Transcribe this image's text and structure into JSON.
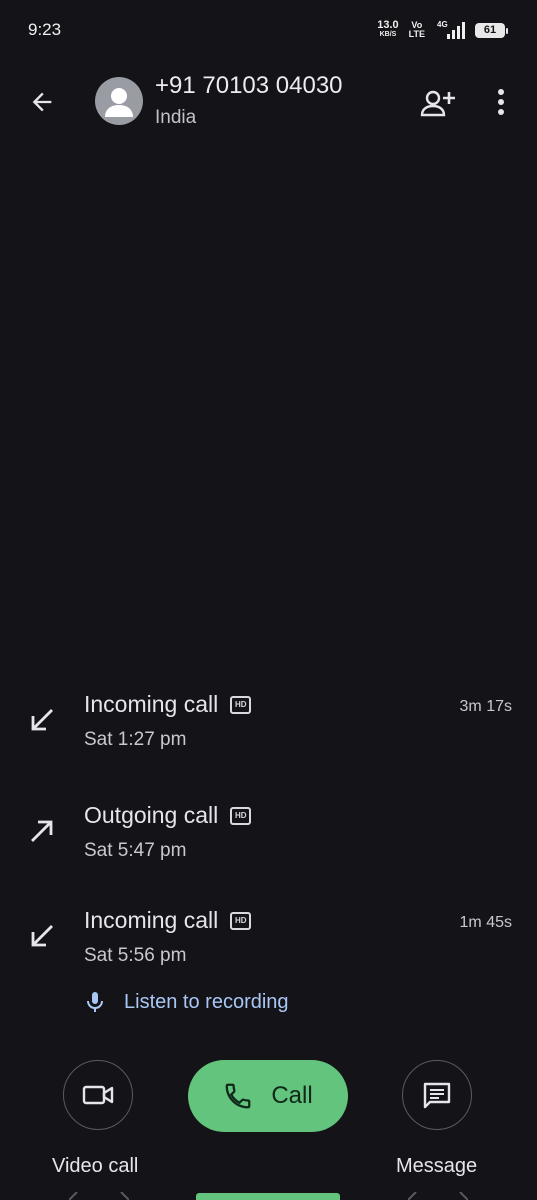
{
  "status_bar": {
    "time": "9:23",
    "net_speed_value": "13.0",
    "net_speed_unit": "KB/S",
    "volte_top": "Vo",
    "volte_bottom": "LTE",
    "network_type": "4G",
    "battery": "61"
  },
  "header": {
    "contact_number": "+91 70103 04030",
    "contact_country": "India"
  },
  "calls": [
    {
      "type": "Incoming call",
      "direction": "incoming",
      "hd": "HD",
      "time": "Sat 1:27 pm",
      "duration": "3m 17s"
    },
    {
      "type": "Outgoing call",
      "direction": "outgoing",
      "hd": "HD",
      "time": "Sat 5:47 pm",
      "duration": ""
    },
    {
      "type": "Incoming call",
      "direction": "incoming",
      "hd": "HD",
      "time": "Sat 5:56 pm",
      "duration": "1m 45s"
    }
  ],
  "recording": {
    "label": "Listen to recording"
  },
  "actions": {
    "video_label": "Video call",
    "call_label": "Call",
    "message_label": "Message"
  },
  "colors": {
    "background": "#131318",
    "accent_green": "#62c47d",
    "link_blue": "#a9c7f5"
  }
}
